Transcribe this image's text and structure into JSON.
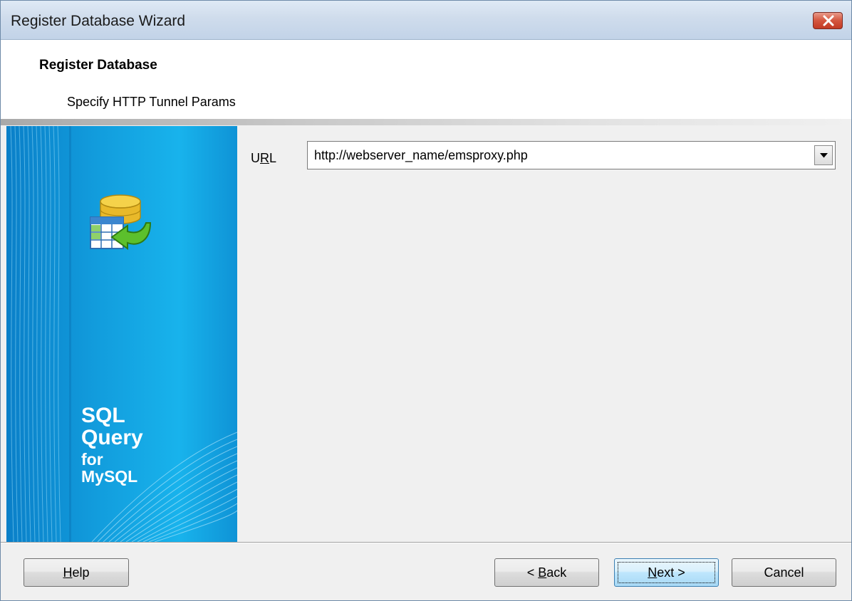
{
  "window": {
    "title": "Register Database Wizard",
    "close_icon": "close-icon",
    "close_color": "#c94a33"
  },
  "header": {
    "title": "Register Database",
    "subtitle": "Specify HTTP Tunnel Params"
  },
  "side_panel": {
    "logo_icon": "database-table-arrow-icon",
    "logo_line1": "SQL",
    "logo_line2": "Query",
    "logo_line3": "for",
    "logo_line4": "MySQL",
    "accent": "#18b3ec"
  },
  "form": {
    "url_label_pre": "U",
    "url_label_accel": "R",
    "url_label_post": "L",
    "url_value": "http://webserver_name/emsproxy.php",
    "dropdown_icon": "chevron-down-icon"
  },
  "buttons": {
    "help_accel": "H",
    "help_rest": "elp",
    "back_pre": "< ",
    "back_accel": "B",
    "back_rest": "ack",
    "next_accel": "N",
    "next_rest": "ext >",
    "cancel": "Cancel"
  }
}
